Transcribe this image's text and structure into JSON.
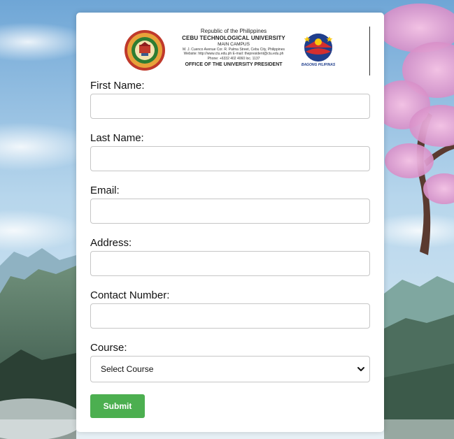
{
  "header": {
    "republic": "Republic of the Philippines",
    "university": "CEBU TECHNOLOGICAL UNIVERSITY",
    "campus": "MAIN CAMPUS",
    "address": "M. J. Cuenco Avenue Cor. R. Palma Street, Cebu City, Philippines",
    "website": "Website: http://www.ctu.edu.ph  E-mail: thepresident@ctu.edu.ph",
    "phone": "Phone: +6332 402 4060 loc. 1137",
    "office": "OFFICE OF THE UNIVERSITY PRESIDENT",
    "gov_logo_caption": "BAGONG PILIPINAS",
    "seal_text": "CEBU TECHNOLOGICAL UNIVERSITY"
  },
  "form": {
    "first_name_label": "First Name:",
    "first_name_value": "",
    "last_name_label": "Last Name:",
    "last_name_value": "",
    "email_label": "Email:",
    "email_value": "",
    "address_label": "Address:",
    "address_value": "",
    "contact_label": "Contact Number:",
    "contact_value": "",
    "course_label": "Course:",
    "course_selected": "Select Course",
    "submit_label": "Submit"
  },
  "colors": {
    "submit_bg": "#4caf50",
    "card_bg": "#ffffff",
    "input_border": "#c6c6c6"
  }
}
